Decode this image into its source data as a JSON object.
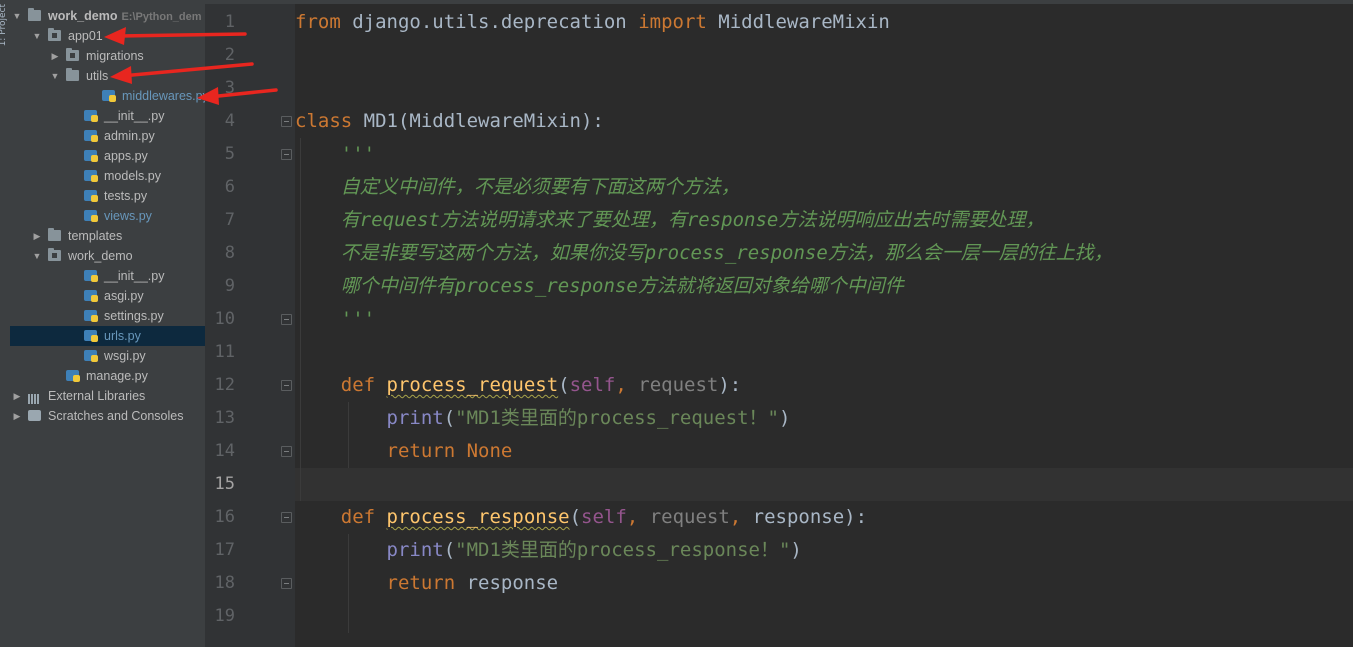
{
  "tree": [
    {
      "label": "work_demo",
      "path": "E:\\Python_dem",
      "depth": 0,
      "arrow": "down",
      "icon": "folder",
      "bold": true
    },
    {
      "label": "app01",
      "depth": 1,
      "arrow": "down",
      "icon": "folder-module"
    },
    {
      "label": "migrations",
      "depth": 2,
      "arrow": "right",
      "icon": "folder-module"
    },
    {
      "label": "utils",
      "depth": 2,
      "arrow": "down",
      "icon": "folder"
    },
    {
      "label": "middlewares.py",
      "depth": 4,
      "icon": "python-file",
      "blue": true
    },
    {
      "label": "__init__.py",
      "depth": 3,
      "icon": "python-file"
    },
    {
      "label": "admin.py",
      "depth": 3,
      "icon": "python-file"
    },
    {
      "label": "apps.py",
      "depth": 3,
      "icon": "python-file"
    },
    {
      "label": "models.py",
      "depth": 3,
      "icon": "python-file"
    },
    {
      "label": "tests.py",
      "depth": 3,
      "icon": "python-file"
    },
    {
      "label": "views.py",
      "depth": 3,
      "icon": "python-file",
      "blue": true
    },
    {
      "label": "templates",
      "depth": 1,
      "arrow": "right",
      "icon": "folder"
    },
    {
      "label": "work_demo",
      "depth": 1,
      "arrow": "down",
      "icon": "folder-module"
    },
    {
      "label": "__init__.py",
      "depth": 3,
      "icon": "python-file"
    },
    {
      "label": "asgi.py",
      "depth": 3,
      "icon": "python-file"
    },
    {
      "label": "settings.py",
      "depth": 3,
      "icon": "python-file"
    },
    {
      "label": "urls.py",
      "depth": 3,
      "icon": "python-file",
      "blue": true,
      "selected": true
    },
    {
      "label": "wsgi.py",
      "depth": 3,
      "icon": "python-file"
    },
    {
      "label": "manage.py",
      "depth": 2,
      "icon": "python-file"
    },
    {
      "label": "External Libraries",
      "depth": 0,
      "arrow": "right",
      "icon": "library"
    },
    {
      "label": "Scratches and Consoles",
      "depth": 0,
      "arrow": "right",
      "icon": "scratch"
    }
  ],
  "side_tab": "1: Project",
  "current_line": 15,
  "lines": [
    [
      [
        "kw",
        "from"
      ],
      [
        "t",
        " django.utils.deprecation "
      ],
      [
        "kw",
        "import"
      ],
      [
        "t",
        " MiddlewareMixin"
      ]
    ],
    [],
    [],
    [
      [
        "kw",
        "class"
      ],
      [
        "t",
        " MD1(MiddlewareMixin):"
      ]
    ],
    [
      [
        "t",
        "    "
      ],
      [
        "doc",
        "'''"
      ]
    ],
    [
      [
        "t",
        "    "
      ],
      [
        "doc",
        "自定义中间件，不是必须要有下面这两个方法，"
      ]
    ],
    [
      [
        "t",
        "    "
      ],
      [
        "doc",
        "有request方法说明请求来了要处理，有response方法说明响应出去时需要处理，"
      ]
    ],
    [
      [
        "t",
        "    "
      ],
      [
        "doc",
        "不是非要写这两个方法，如果你没写process_response方法，那么会一层一层的往上找，"
      ]
    ],
    [
      [
        "t",
        "    "
      ],
      [
        "doc",
        "哪个中间件有process_response方法就将返回对象给哪个中间件"
      ]
    ],
    [
      [
        "t",
        "    "
      ],
      [
        "doc",
        "'''"
      ]
    ],
    [],
    [
      [
        "t",
        "    "
      ],
      [
        "kw",
        "def"
      ],
      [
        "t",
        " "
      ],
      [
        "fn",
        "process_request"
      ],
      [
        "t",
        "("
      ],
      [
        "self",
        "self"
      ],
      [
        "kw",
        ","
      ],
      [
        "gray",
        " request"
      ],
      [
        "t",
        "):"
      ]
    ],
    [
      [
        "t",
        "        "
      ],
      [
        "bi",
        "print"
      ],
      [
        "t",
        "("
      ],
      [
        "str",
        "\"MD1类里面的process_request！\""
      ],
      [
        "t",
        ")"
      ]
    ],
    [
      [
        "t",
        "        "
      ],
      [
        "kw",
        "return"
      ],
      [
        "t",
        " "
      ],
      [
        "kw",
        "None"
      ]
    ],
    [],
    [
      [
        "t",
        "    "
      ],
      [
        "kw",
        "def"
      ],
      [
        "t",
        " "
      ],
      [
        "fn",
        "process_response"
      ],
      [
        "t",
        "("
      ],
      [
        "self",
        "self"
      ],
      [
        "kw",
        ","
      ],
      [
        "gray",
        " request"
      ],
      [
        "kw",
        ","
      ],
      [
        "t",
        " response):"
      ]
    ],
    [
      [
        "t",
        "        "
      ],
      [
        "bi",
        "print"
      ],
      [
        "t",
        "("
      ],
      [
        "str",
        "\"MD1类里面的process_response！\""
      ],
      [
        "t",
        ")"
      ]
    ],
    [
      [
        "t",
        "        "
      ],
      [
        "kw",
        "return"
      ],
      [
        "t",
        " response"
      ]
    ],
    []
  ],
  "colors": {
    "keyword": "#cc7832",
    "function": "#ffc66d",
    "string": "#6a8759",
    "docstring": "#629755",
    "self": "#94558d",
    "builtin": "#8888c6",
    "annotation_arrow": "#e8261f"
  }
}
